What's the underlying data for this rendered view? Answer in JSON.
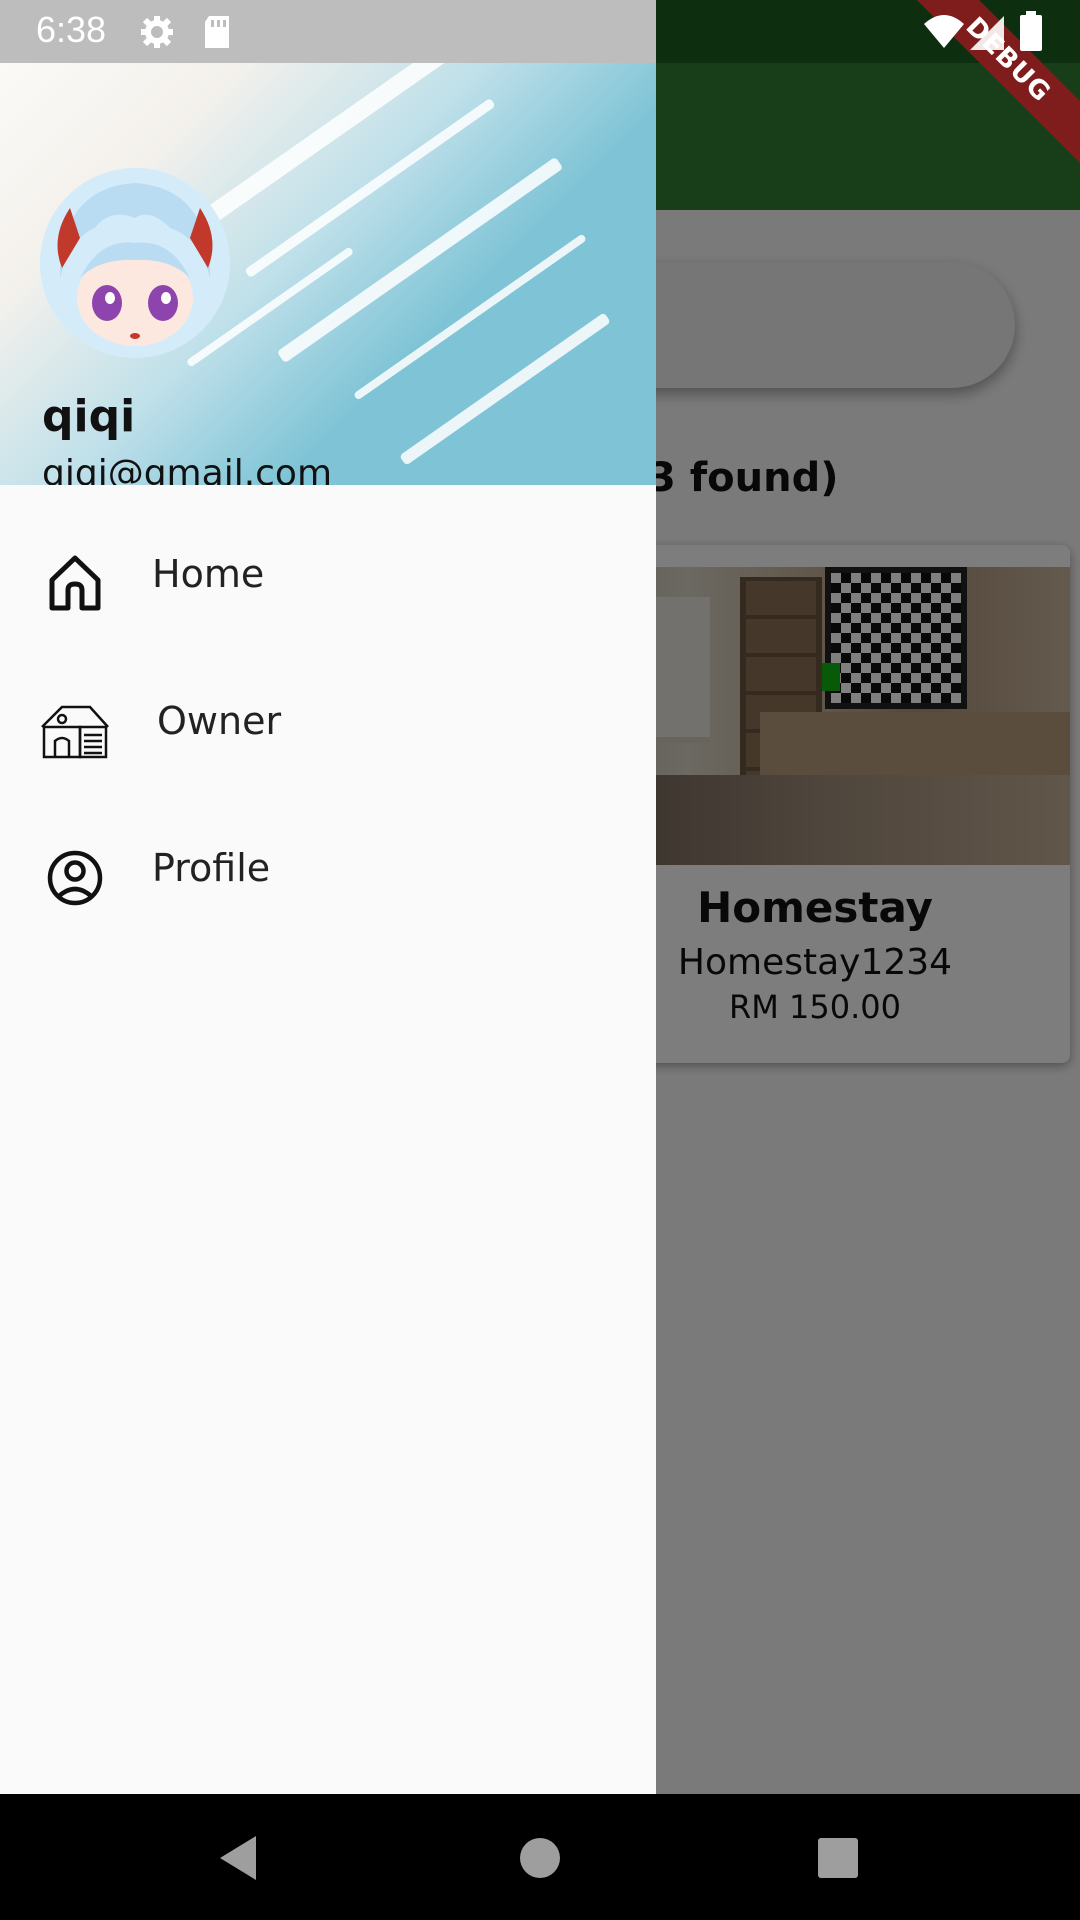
{
  "status_bar": {
    "time": "6:38",
    "icons": [
      "gear-icon",
      "sd-card-icon",
      "wifi-icon",
      "signal-icon",
      "battery-icon"
    ]
  },
  "debug_banner": "DEBUG",
  "background": {
    "results_text": "3 found)",
    "card": {
      "title": "Homestay",
      "subtitle": "Homestay1234",
      "price": "RM 150.00"
    }
  },
  "drawer": {
    "user": {
      "name": "qiqi",
      "email": "qiqi@gmail.com"
    },
    "items": [
      {
        "label": "Home",
        "icon": "home-icon"
      },
      {
        "label": "Owner",
        "icon": "house-building-icon"
      },
      {
        "label": "Profile",
        "icon": "account-circle-icon"
      }
    ]
  },
  "nav_bar": {
    "buttons": [
      "back-icon",
      "home-circle-icon",
      "recents-icon"
    ]
  },
  "colors": {
    "app_bar": "#2e7d32",
    "drawer_bg": "#fafafa",
    "header_blue": "#7ec3d6",
    "debug_red": "#7f1d1d"
  }
}
